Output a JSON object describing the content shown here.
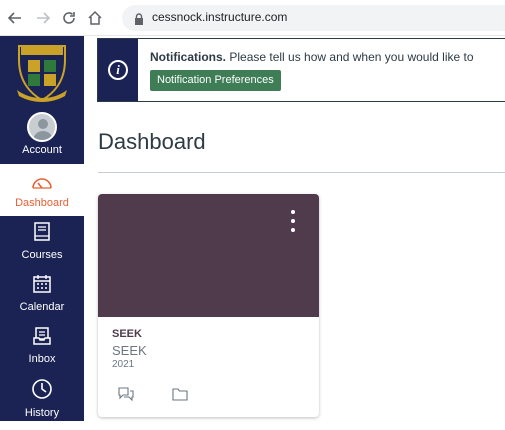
{
  "browser": {
    "url": "cessnock.instructure.com"
  },
  "global_nav": {
    "items": [
      {
        "label": "Account",
        "icon": "avatar-icon"
      },
      {
        "label": "Dashboard",
        "icon": "dashboard-icon"
      },
      {
        "label": "Courses",
        "icon": "book-icon"
      },
      {
        "label": "Calendar",
        "icon": "calendar-icon"
      },
      {
        "label": "Inbox",
        "icon": "inbox-icon"
      },
      {
        "label": "History",
        "icon": "clock-icon"
      }
    ],
    "active": "Dashboard"
  },
  "notification": {
    "title": "Notifications.",
    "message": " Please tell us how and when you would like to",
    "button": "Notification Preferences"
  },
  "page": {
    "title": "Dashboard"
  },
  "course_card": {
    "code": "SEEK",
    "name": "SEEK",
    "term": "2021",
    "hero_color": "#4f3b4b"
  },
  "colors": {
    "nav_bg": "#1b2354",
    "accent": "#e66135",
    "button_green": "#3f7d57"
  }
}
